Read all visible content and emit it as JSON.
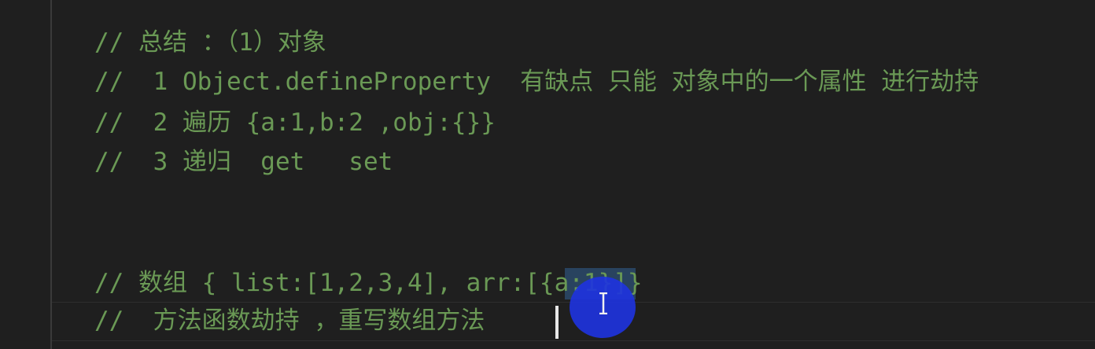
{
  "editor": {
    "lines": [
      "// 总结 ：（1）对象",
      "//  1 Object.defineProperty  有缺点 只能 对象中的一个属性 进行劫持",
      "//  2 遍历 {a:1,b:2 ,obj:{}}",
      "//  3 递归  get   set",
      "// 数组 { list:[1,2,3,4], arr:[{a:1}]}",
      "//  方法函数劫持 ，重写数组方法 "
    ],
    "comment_color": "#6a9955",
    "background_color": "#1f1f1f",
    "selection_color": "#2b4a6b"
  },
  "cursor": {
    "icon": "i-beam-cursor-icon"
  },
  "click_highlight": {
    "color": "#1e33e0"
  }
}
